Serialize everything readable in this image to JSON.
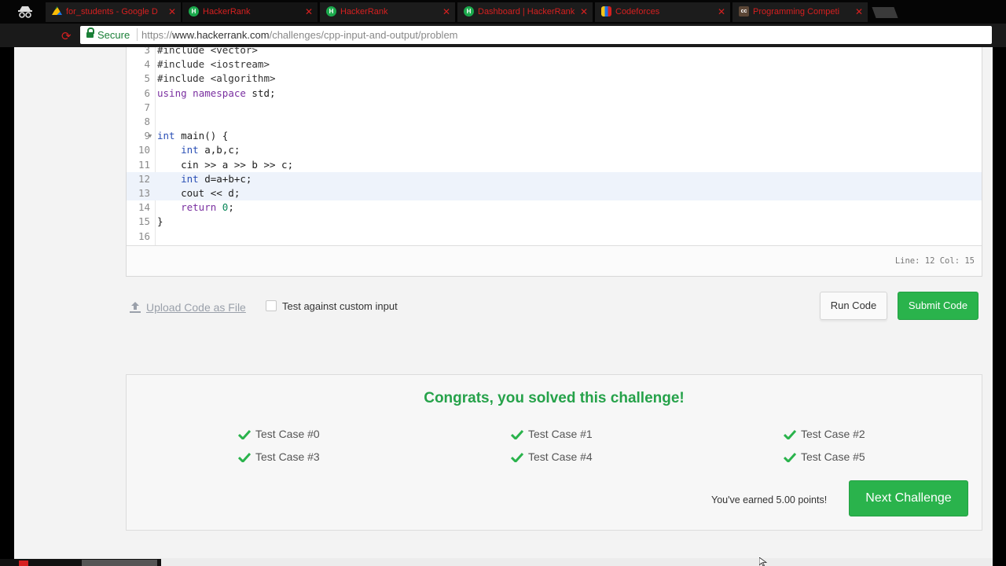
{
  "browser": {
    "tabs": [
      {
        "title": "for_students - Google D",
        "favicon": "drive-icon"
      },
      {
        "title": "HackerRank",
        "favicon": "hackerrank-icon",
        "active": true
      },
      {
        "title": "HackerRank",
        "favicon": "hackerrank-icon"
      },
      {
        "title": "Dashboard | HackerRank",
        "favicon": "hackerrank-icon"
      },
      {
        "title": "Codeforces",
        "favicon": "codeforces-icon"
      },
      {
        "title": "Programming Competi",
        "favicon": "codechef-icon"
      }
    ],
    "secure_label": "Secure",
    "url_prefix": "https://",
    "url_host": "www.hackerrank.com",
    "url_path": "/challenges/cpp-input-and-output/problem"
  },
  "editor": {
    "lines": [
      {
        "n": "3",
        "text": "#include <vector>"
      },
      {
        "n": "4",
        "text": "#include <iostream>"
      },
      {
        "n": "5",
        "text": "#include <algorithm>"
      },
      {
        "n": "6",
        "text": "using namespace std;"
      },
      {
        "n": "7",
        "text": ""
      },
      {
        "n": "8",
        "text": ""
      },
      {
        "n": "9",
        "text": "int main() {"
      },
      {
        "n": "10",
        "text": "    int a,b,c;"
      },
      {
        "n": "11",
        "text": "    cin >> a >> b >> c;"
      },
      {
        "n": "12",
        "text": "    int d=a+b+c;"
      },
      {
        "n": "13",
        "text": "    cout << d;"
      },
      {
        "n": "14",
        "text": "    return 0;"
      },
      {
        "n": "15",
        "text": "}"
      },
      {
        "n": "16",
        "text": ""
      }
    ],
    "cursor_position": "Line: 12 Col: 15"
  },
  "actions": {
    "upload_label": "Upload Code as File",
    "custom_input_label": "Test against custom input",
    "run_label": "Run Code",
    "submit_label": "Submit Code"
  },
  "result": {
    "title": "Congrats, you solved this challenge!",
    "test_cases": [
      "Test Case #0",
      "Test Case #1",
      "Test Case #2",
      "Test Case #3",
      "Test Case #4",
      "Test Case #5"
    ],
    "earned_text": "You've earned 5.00 points!",
    "next_label": "Next Challenge"
  },
  "colors": {
    "accent_green": "#2ab34c",
    "success_text": "#26a24a",
    "tab_text": "#d62020"
  }
}
